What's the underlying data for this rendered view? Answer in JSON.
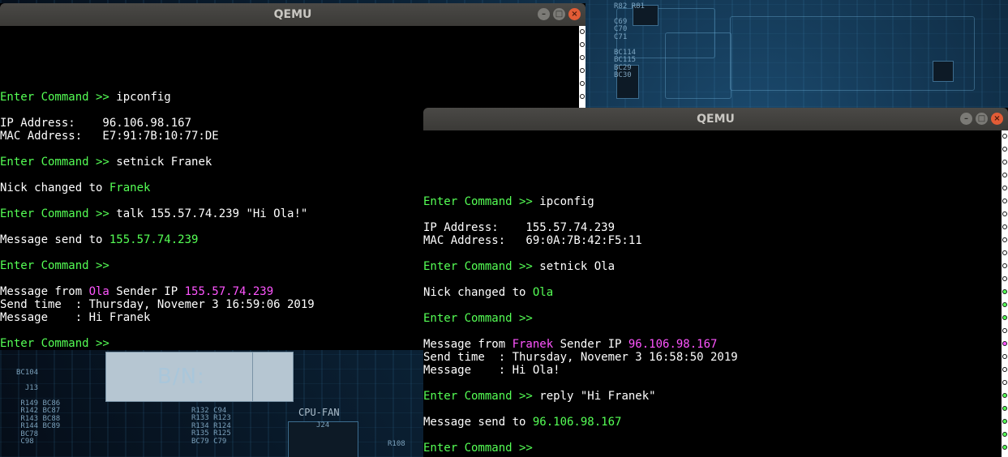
{
  "desktop": {
    "pcb_top_labels": "R82 R81\n\nC69\nC70\nC71\n\nBC114\nBC115\nBC29\nBC30",
    "pcb_bottom_left": "BC104\n\n  J13\n\n R149 BC86\n R142 BC87\n R143 BC88\n R144 BC89\n BC78\n C98",
    "pcb_bottom_mid": "R132 C94\nR133 R123\nR134 R124\nR135 R125\nBC79 C79",
    "bn_label": "B/N:",
    "cpu_fan_label": "CPU-FAN",
    "j24_label": "J24",
    "r108_label": "R108"
  },
  "left_window": {
    "title": "QEMU",
    "lines": [
      {
        "text": ""
      },
      {
        "text": ""
      },
      {
        "text": ""
      },
      {
        "text": ""
      },
      {
        "text": ""
      },
      {
        "prompt": "Enter Command >> ",
        "text": "ipconfig"
      },
      {
        "text": ""
      },
      {
        "text": "IP Address:    96.106.98.167"
      },
      {
        "text": "MAC Address:   E7:91:7B:10:77:DE"
      },
      {
        "text": ""
      },
      {
        "prompt": "Enter Command >> ",
        "text": "setnick Franek"
      },
      {
        "text": ""
      },
      {
        "text": "Nick changed to ",
        "green": "Franek"
      },
      {
        "text": ""
      },
      {
        "prompt": "Enter Command >> ",
        "text": "talk 155.57.74.239 \"Hi Ola!\""
      },
      {
        "text": ""
      },
      {
        "text": "Message send to ",
        "green": "155.57.74.239"
      },
      {
        "text": ""
      },
      {
        "prompt": "Enter Command >> ",
        "text": ""
      },
      {
        "text": ""
      },
      {
        "text": "Message from ",
        "magenta": "Ola",
        "text2": " Sender IP ",
        "magenta2": "155.57.74.239"
      },
      {
        "text": "Send time  : Thursday, Novemer 3 16:59:06 2019"
      },
      {
        "text": "Message    : Hi Franek"
      },
      {
        "text": ""
      },
      {
        "prompt": "Enter Command >> ",
        "text": ""
      }
    ]
  },
  "right_window": {
    "title": "QEMU",
    "lines": [
      {
        "text": ""
      },
      {
        "text": ""
      },
      {
        "text": ""
      },
      {
        "text": ""
      },
      {
        "text": ""
      },
      {
        "prompt": "Enter Command >> ",
        "text": "ipconfig"
      },
      {
        "text": ""
      },
      {
        "text": "IP Address:    155.57.74.239"
      },
      {
        "text": "MAC Address:   69:0A:7B:42:F5:11"
      },
      {
        "text": ""
      },
      {
        "prompt": "Enter Command >> ",
        "text": "setnick Ola"
      },
      {
        "text": ""
      },
      {
        "text": "Nick changed to ",
        "green": "Ola"
      },
      {
        "text": ""
      },
      {
        "prompt": "Enter Command >> ",
        "text": ""
      },
      {
        "text": ""
      },
      {
        "text": "Message from ",
        "magenta": "Franek",
        "text2": " Sender IP ",
        "magenta2": "96.106.98.167"
      },
      {
        "text": "Send time  : Thursday, Novemer 3 16:58:50 2019"
      },
      {
        "text": "Message    : Hi Ola!"
      },
      {
        "text": ""
      },
      {
        "prompt": "Enter Command >> ",
        "text": "reply \"Hi Franek\""
      },
      {
        "text": ""
      },
      {
        "text": "Message send to ",
        "green": "96.106.98.167"
      },
      {
        "text": ""
      },
      {
        "prompt": "Enter Command >> ",
        "text": ""
      }
    ]
  },
  "window_controls": {
    "minimize": "–",
    "maximize": "□",
    "close": "×"
  },
  "colors": {
    "prompt": "#55ff55",
    "highlight_green": "#55ff55",
    "highlight_magenta": "#ff55ff",
    "console_bg": "#000000",
    "console_fg": "#ffffff"
  }
}
